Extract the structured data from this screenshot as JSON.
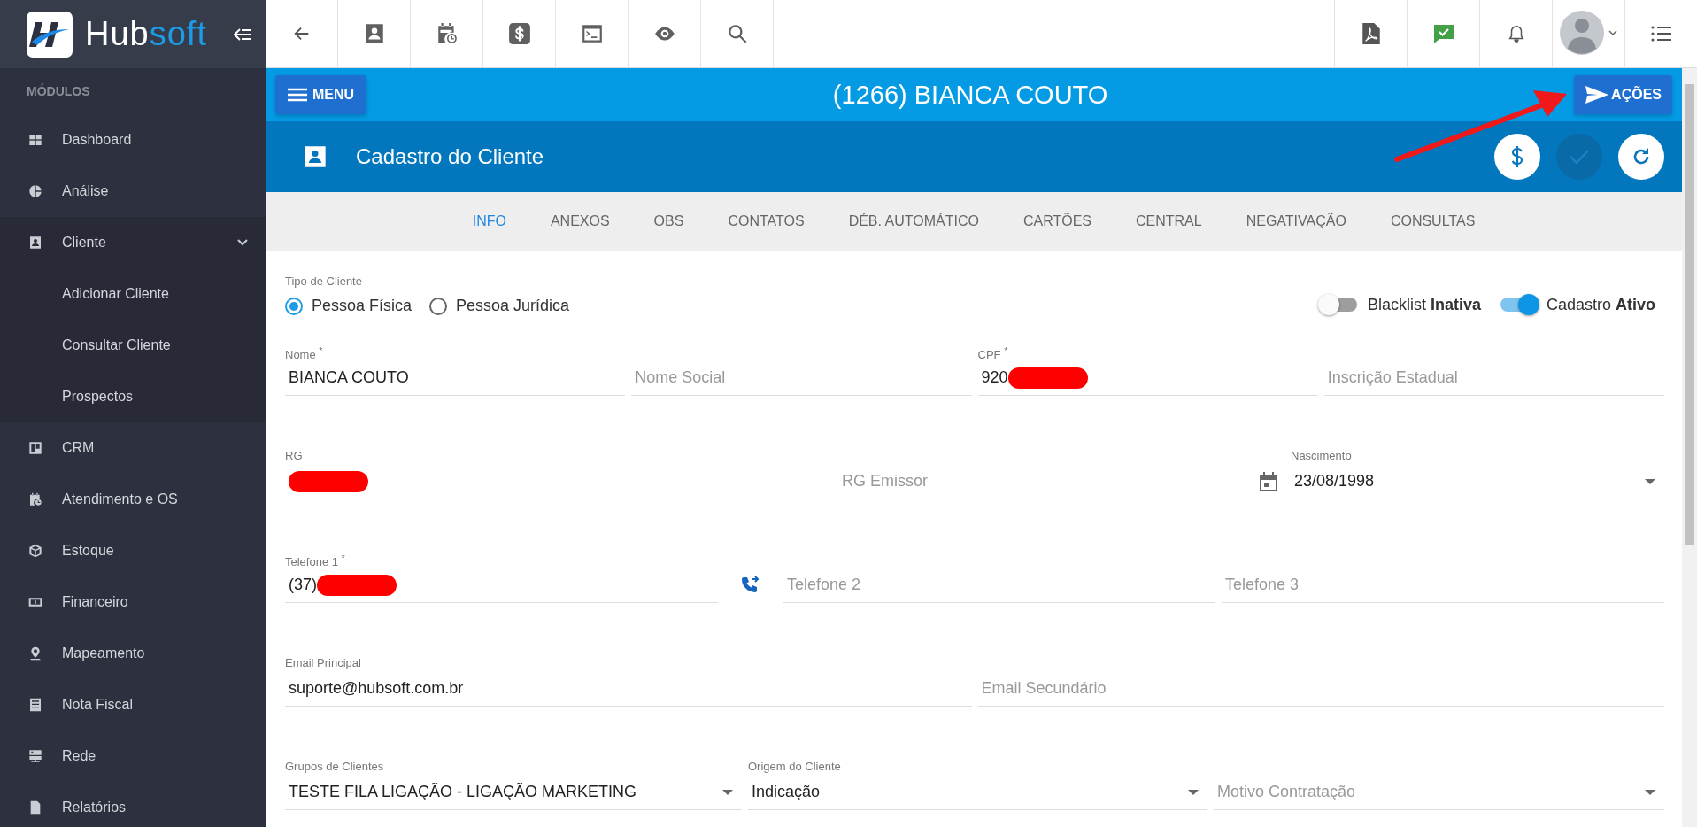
{
  "sidebar": {
    "logo": {
      "part_1": "Hub",
      "part_2": "soft"
    },
    "section_title": "MÓDULOS",
    "items": [
      {
        "label": "Dashboard"
      },
      {
        "label": "Análise"
      },
      {
        "label": "Cliente",
        "expanded": true,
        "children": [
          {
            "label": "Adicionar Cliente"
          },
          {
            "label": "Consultar Cliente"
          },
          {
            "label": "Prospectos"
          }
        ]
      },
      {
        "label": "CRM"
      },
      {
        "label": "Atendimento e OS"
      },
      {
        "label": "Estoque"
      },
      {
        "label": "Financeiro"
      },
      {
        "label": "Mapeamento"
      },
      {
        "label": "Nota Fiscal"
      },
      {
        "label": "Rede"
      },
      {
        "label": "Relatórios"
      }
    ]
  },
  "header": {
    "menu_button": "MENU",
    "title": "(1266) BIANCA COUTO",
    "actions_button": "AÇÕES"
  },
  "section": {
    "title": "Cadastro do Cliente",
    "action_buttons": [
      {
        "kind": "money",
        "disabled": false
      },
      {
        "kind": "confirm",
        "disabled": true
      },
      {
        "kind": "refresh",
        "disabled": false
      }
    ]
  },
  "tabs": [
    {
      "label": "INFO",
      "selected": true
    },
    {
      "label": "ANEXOS",
      "selected": false
    },
    {
      "label": "OBS",
      "selected": false
    },
    {
      "label": "CONTATOS",
      "selected": false
    },
    {
      "label": "DÉB. AUTOMÁTICO",
      "selected": false
    },
    {
      "label": "CARTÕES",
      "selected": false
    },
    {
      "label": "CENTRAL",
      "selected": false
    },
    {
      "label": "NEGATIVAÇÃO",
      "selected": false
    },
    {
      "label": "CONSULTAS",
      "selected": false
    }
  ],
  "form": {
    "client_type": {
      "label": "Tipo de Cliente",
      "options": [
        {
          "label": "Pessoa Física",
          "selected": true
        },
        {
          "label": "Pessoa Jurídica",
          "selected": false
        }
      ]
    },
    "toggles": [
      {
        "label": "Blacklist **Inativa**",
        "on": false
      },
      {
        "label": "Cadastro **Ativo**",
        "on": true
      }
    ],
    "rows": [
      [
        {
          "kind": "text",
          "label": "Nome $^{*}$",
          "value": "BIANCA COUTO"
        },
        {
          "kind": "text",
          "placeholder": "Nome Social"
        },
        {
          "kind": "text",
          "label": "CPF $^{*}$",
          "value": "920",
          "redacted": true
        },
        {
          "kind": "text",
          "placeholder": "Inscrição Estadual"
        }
      ],
      [
        {
          "kind": "text",
          "label": "RG",
          "redacted": true
        },
        {
          "kind": "text",
          "placeholder": "RG Emissor"
        },
        {
          "kind": "date",
          "label": "Nascimento",
          "value": "23/08/1998"
        }
      ],
      [
        {
          "kind": "text",
          "label": "Telefone 1 $^{*}$",
          "value": "(37)",
          "redacted": true
        },
        {
          "kind": "phone-action"
        },
        {
          "kind": "text",
          "placeholder": "Telefone 2"
        },
        {
          "kind": "text",
          "placeholder": "Telefone 3"
        }
      ],
      [
        {
          "kind": "text",
          "label": "Email Principal",
          "value": "suporte@hubsoft.com.br"
        },
        {
          "kind": "text",
          "placeholder": "Email Secundário"
        }
      ],
      [
        {
          "kind": "select",
          "label": "Grupos de Clientes",
          "value": "TESTE FILA LIGAÇÃO - LIGAÇÃO MARKETING"
        },
        {
          "kind": "select",
          "label": "Origem do Cliente",
          "value": "Indicação"
        },
        {
          "kind": "select",
          "placeholder": "Motivo Contratação"
        }
      ]
    ]
  }
}
